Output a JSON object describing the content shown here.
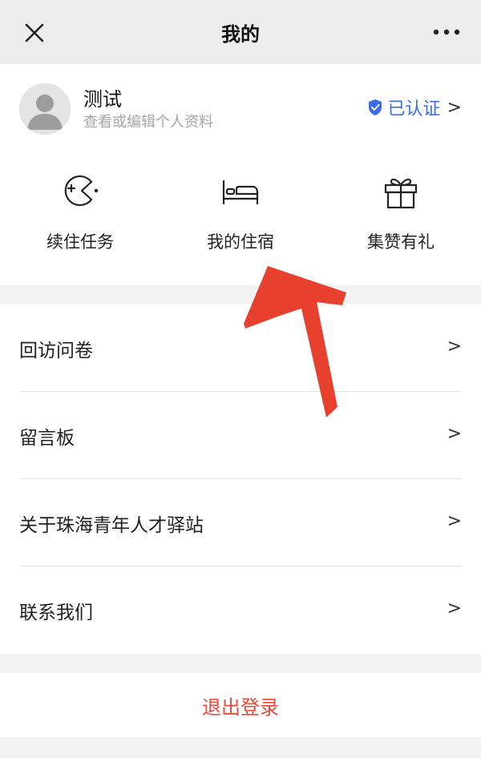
{
  "navbar": {
    "title": "我的"
  },
  "profile": {
    "username": "测试",
    "hint": "查看或编辑个人资料",
    "verified_label": "已认证",
    "verified_chevron": ">"
  },
  "shortcuts": [
    {
      "label": "续住任务",
      "icon": "pacman-icon"
    },
    {
      "label": "我的住宿",
      "icon": "bed-icon"
    },
    {
      "label": "集赞有礼",
      "icon": "gift-icon"
    }
  ],
  "menu": [
    {
      "label": "回访问卷",
      "chevron": ">"
    },
    {
      "label": "留言板",
      "chevron": ">"
    },
    {
      "label": "关于珠海青年人才驿站",
      "chevron": ">"
    },
    {
      "label": "联系我们",
      "chevron": ">"
    }
  ],
  "logout": {
    "label": "退出登录"
  },
  "colors": {
    "accent_blue": "#3a6ee8",
    "danger_red": "#e8483a",
    "annotation_red": "#e8402f"
  }
}
